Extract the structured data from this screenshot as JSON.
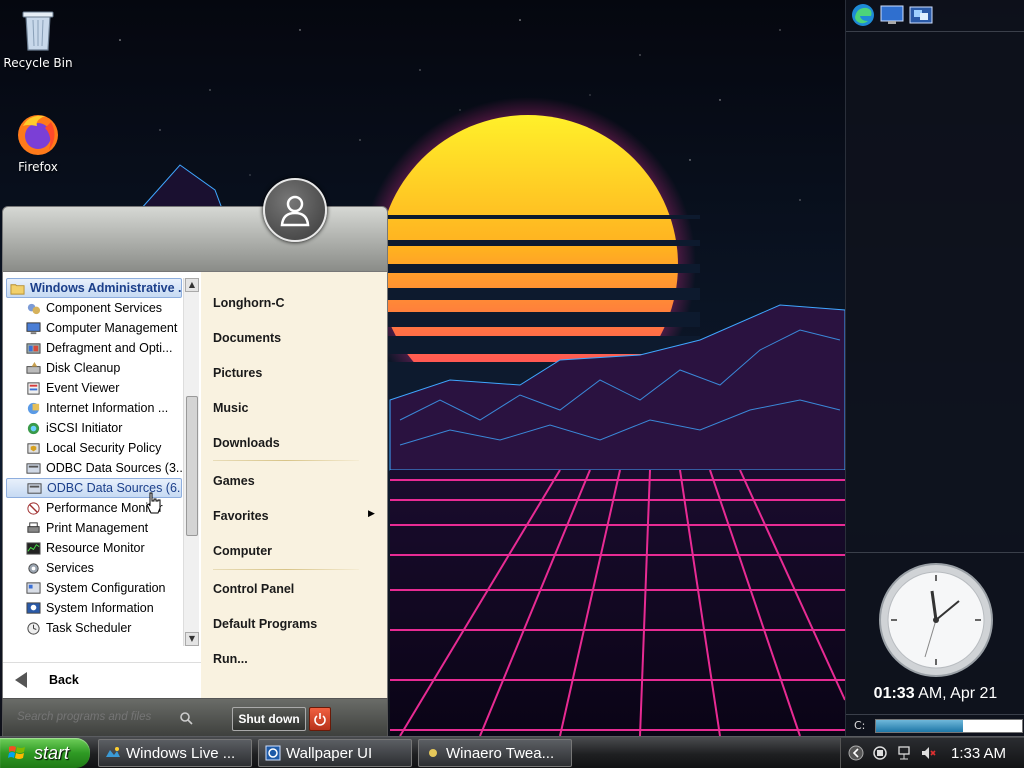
{
  "desktop": {
    "icons": [
      {
        "label": "Recycle Bin"
      },
      {
        "label": "Firefox"
      }
    ]
  },
  "start_menu": {
    "programs": {
      "folder": "Windows Administrative ...",
      "items": [
        "Component Services",
        "Computer Management",
        "Defragment and Opti...",
        "Disk Cleanup",
        "Event Viewer",
        "Internet Information ...",
        "iSCSI Initiator",
        "Local Security Policy",
        "ODBC Data Sources (3...",
        "ODBC Data Sources (6...",
        "Performance Monitor",
        "Print Management",
        "Resource Monitor",
        "Services",
        "System Configuration",
        "System Information",
        "Task Scheduler"
      ],
      "selected": "ODBC Data Sources (6..."
    },
    "back_label": "Back",
    "right_items": {
      "user": "Longhorn-C",
      "documents": "Documents",
      "pictures": "Pictures",
      "music": "Music",
      "downloads": "Downloads",
      "games": "Games",
      "favorites": "Favorites",
      "computer": "Computer",
      "control_panel": "Control Panel",
      "default_programs": "Default Programs",
      "run": "Run..."
    },
    "search_placeholder": "Search programs and files",
    "shutdown_label": "Shut down"
  },
  "taskbar": {
    "start_label": "start",
    "buttons": [
      {
        "label": "Windows Live ..."
      },
      {
        "label": "Wallpaper UI"
      },
      {
        "label": "Winaero Twea..."
      }
    ],
    "tray_time": "1:33 AM"
  },
  "sidebar": {
    "clock": {
      "time": "01:33",
      "suffix": "AM, Apr 21"
    },
    "drive": {
      "label": "C:",
      "used_fraction": 0.59
    }
  },
  "colors": {
    "start_green": "#2f9a24",
    "selection_blue": "#c6daf3",
    "wallpaper_pink": "#ff2fa0",
    "wallpaper_sun": "#ffb020"
  }
}
